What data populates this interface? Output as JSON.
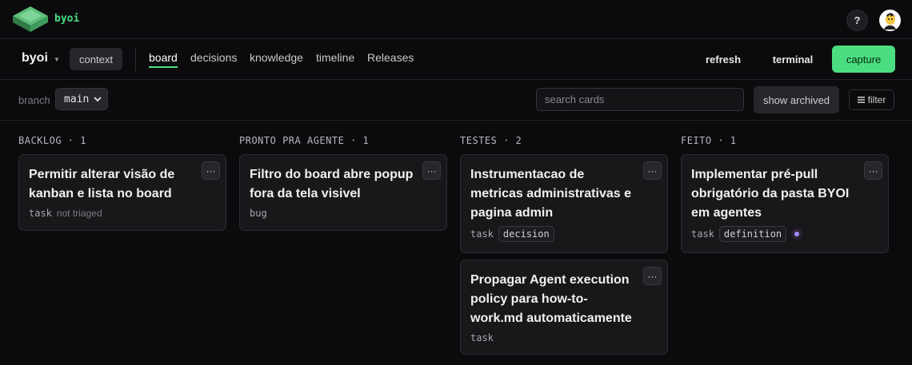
{
  "app": {
    "brand": "byoi",
    "help_label": "?"
  },
  "nav": {
    "project": "byoi",
    "context_label": "context",
    "tabs": [
      {
        "label": "board",
        "active": true
      },
      {
        "label": "decisions",
        "active": false
      },
      {
        "label": "knowledge",
        "active": false
      },
      {
        "label": "timeline",
        "active": false
      },
      {
        "label": "Releases",
        "active": false
      }
    ],
    "refresh_label": "refresh",
    "terminal_label": "terminal",
    "capture_label": "capture"
  },
  "filters": {
    "branch_label": "branch",
    "branch_value": "main",
    "search_placeholder": "search cards",
    "archived_label": "show archived",
    "filter_label": "filter"
  },
  "colors": {
    "accent": "#4ade80",
    "background": "#0b0b0d",
    "card": "#18181b",
    "badge_dot": "#a78bfa"
  },
  "columns": [
    {
      "header": "BACKLOG · 1",
      "cards": [
        {
          "title": "Permitir alterar visão de kanban e lista no board",
          "kind": "task",
          "note": "not triaged",
          "tag": null
        }
      ]
    },
    {
      "header": "PRONTO PRA AGENTE · 1",
      "cards": [
        {
          "title": "Filtro do board abre popup fora da tela visivel",
          "kind": "bug",
          "note": null,
          "tag": null
        }
      ]
    },
    {
      "header": "TESTES · 2",
      "cards": [
        {
          "title": "Instrumentacao de metricas administrativas e pagina admin",
          "kind": "task",
          "note": null,
          "tag": "decision"
        },
        {
          "title": "Propagar Agent execution policy para how-to-work.md automaticamente",
          "kind": "task",
          "note": null,
          "tag": null
        }
      ]
    },
    {
      "header": "FEITO · 1",
      "cards": [
        {
          "title": "Implementar pré-pull obrigatório da pasta BYOI em agentes",
          "kind": "task",
          "note": null,
          "tag": "definition",
          "badge": "purple-dot"
        }
      ]
    }
  ],
  "card_menu_label": "···"
}
